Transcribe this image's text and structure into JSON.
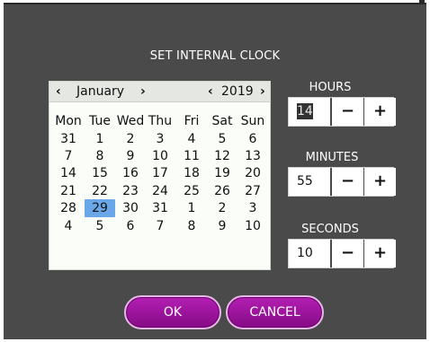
{
  "dialog": {
    "title": "SET INTERNAL CLOCK"
  },
  "calendar": {
    "prev_month": "‹",
    "month": "January",
    "next_month": "›",
    "prev_year": "‹",
    "year": "2019",
    "next_year": "›",
    "weekdays": [
      "Mon",
      "Tue",
      "Wed",
      "Thu",
      "Fri",
      "Sat",
      "Sun"
    ],
    "weeks": [
      [
        "31",
        "1",
        "2",
        "3",
        "4",
        "5",
        "6"
      ],
      [
        "7",
        "8",
        "9",
        "10",
        "11",
        "12",
        "13"
      ],
      [
        "14",
        "15",
        "16",
        "17",
        "18",
        "19",
        "20"
      ],
      [
        "21",
        "22",
        "23",
        "24",
        "25",
        "26",
        "27"
      ],
      [
        "28",
        "29",
        "30",
        "31",
        "1",
        "2",
        "3"
      ],
      [
        "4",
        "5",
        "6",
        "7",
        "8",
        "9",
        "10"
      ]
    ],
    "selected_day": "29",
    "selected_color": "#6aa7e8"
  },
  "hours": {
    "label": "HOURS",
    "value": "14",
    "minus": "−",
    "plus": "+"
  },
  "minutes": {
    "label": "MINUTES",
    "value": "55",
    "minus": "−",
    "plus": "+"
  },
  "seconds": {
    "label": "SECONDS",
    "value": "10",
    "minus": "−",
    "plus": "+"
  },
  "buttons": {
    "ok": "OK",
    "cancel": "CANCEL"
  },
  "colors": {
    "background": "#4a4a4a",
    "accent": "#a010a0"
  }
}
